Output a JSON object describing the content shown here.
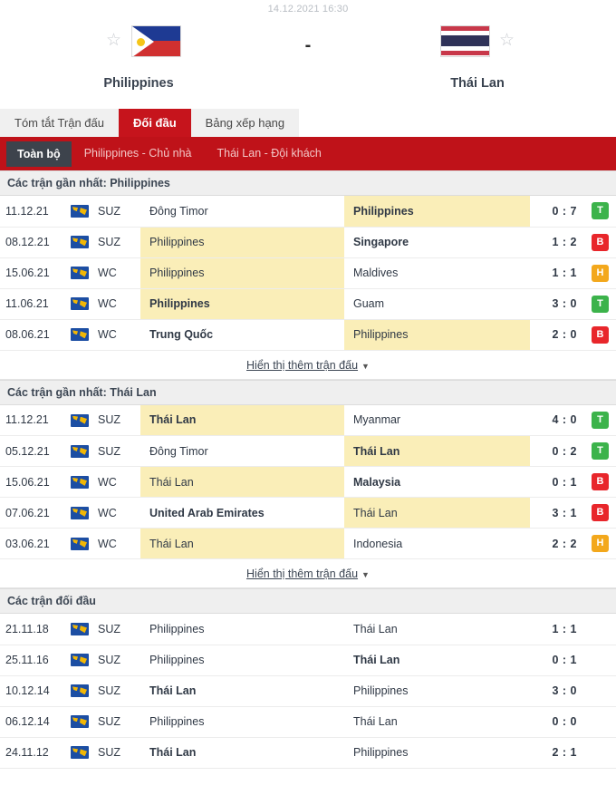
{
  "header": {
    "datetime": "14.12.2021 16:30",
    "home_team": "Philippines",
    "away_team": "Thái Lan",
    "score_separator": "-",
    "star_icon": "star-outline-icon",
    "home_flag": "philippines-flag",
    "away_flag": "thailand-flag"
  },
  "tabs": [
    {
      "label": "Tóm tắt Trận đấu",
      "active": false
    },
    {
      "label": "Đối đầu",
      "active": true
    },
    {
      "label": "Bảng xếp hạng",
      "active": false
    }
  ],
  "filters": [
    {
      "label": "Toàn bộ",
      "active": true
    },
    {
      "label": "Philippines - Chủ nhà",
      "active": false
    },
    {
      "label": "Thái Lan - Đội khách",
      "active": false
    }
  ],
  "show_more_label": "Hiển thị thêm trận đấu",
  "show_more_icon": "chevron-down-icon",
  "competition_icon": "world-map-icon",
  "colors": {
    "brand_red": "#bf1219",
    "tab_red": "#c6141c",
    "dark_chip": "#3d434c",
    "highlight_yellow": "#faeeb8",
    "win_green": "#3cb34b",
    "loss_red": "#e8262b",
    "draw_orange": "#f3a81c"
  },
  "sections": [
    {
      "title": "Các trận gần nhất: Philippines",
      "has_result_badge": true,
      "has_show_more": true,
      "rows": [
        {
          "date": "11.12.21",
          "comp": "SUZ",
          "home": "Đông Timor",
          "away": "Philippines",
          "score": "0 : 7",
          "result": "T",
          "home_bold": false,
          "away_bold": true,
          "home_hl": false,
          "away_hl": true
        },
        {
          "date": "08.12.21",
          "comp": "SUZ",
          "home": "Philippines",
          "away": "Singapore",
          "score": "1 : 2",
          "result": "B",
          "home_bold": false,
          "away_bold": true,
          "home_hl": true,
          "away_hl": false
        },
        {
          "date": "15.06.21",
          "comp": "WC",
          "home": "Philippines",
          "away": "Maldives",
          "score": "1 : 1",
          "result": "H",
          "home_bold": false,
          "away_bold": false,
          "home_hl": true,
          "away_hl": false
        },
        {
          "date": "11.06.21",
          "comp": "WC",
          "home": "Philippines",
          "away": "Guam",
          "score": "3 : 0",
          "result": "T",
          "home_bold": true,
          "away_bold": false,
          "home_hl": true,
          "away_hl": false
        },
        {
          "date": "08.06.21",
          "comp": "WC",
          "home": "Trung Quốc",
          "away": "Philippines",
          "score": "2 : 0",
          "result": "B",
          "home_bold": true,
          "away_bold": false,
          "home_hl": false,
          "away_hl": true
        }
      ]
    },
    {
      "title": "Các trận gần nhất: Thái Lan",
      "has_result_badge": true,
      "has_show_more": true,
      "rows": [
        {
          "date": "11.12.21",
          "comp": "SUZ",
          "home": "Thái Lan",
          "away": "Myanmar",
          "score": "4 : 0",
          "result": "T",
          "home_bold": true,
          "away_bold": false,
          "home_hl": true,
          "away_hl": false
        },
        {
          "date": "05.12.21",
          "comp": "SUZ",
          "home": "Đông Timor",
          "away": "Thái Lan",
          "score": "0 : 2",
          "result": "T",
          "home_bold": false,
          "away_bold": true,
          "home_hl": false,
          "away_hl": true
        },
        {
          "date": "15.06.21",
          "comp": "WC",
          "home": "Thái Lan",
          "away": "Malaysia",
          "score": "0 : 1",
          "result": "B",
          "home_bold": false,
          "away_bold": true,
          "home_hl": true,
          "away_hl": false
        },
        {
          "date": "07.06.21",
          "comp": "WC",
          "home": "United Arab Emirates",
          "away": "Thái Lan",
          "score": "3 : 1",
          "result": "B",
          "home_bold": true,
          "away_bold": false,
          "home_hl": false,
          "away_hl": true
        },
        {
          "date": "03.06.21",
          "comp": "WC",
          "home": "Thái Lan",
          "away": "Indonesia",
          "score": "2 : 2",
          "result": "H",
          "home_bold": false,
          "away_bold": false,
          "home_hl": true,
          "away_hl": false
        }
      ]
    },
    {
      "title": "Các trận đối đầu",
      "has_result_badge": false,
      "has_show_more": false,
      "rows": [
        {
          "date": "21.11.18",
          "comp": "SUZ",
          "home": "Philippines",
          "away": "Thái Lan",
          "score": "1 : 1",
          "result": "",
          "home_bold": false,
          "away_bold": false,
          "home_hl": false,
          "away_hl": false
        },
        {
          "date": "25.11.16",
          "comp": "SUZ",
          "home": "Philippines",
          "away": "Thái Lan",
          "score": "0 : 1",
          "result": "",
          "home_bold": false,
          "away_bold": true,
          "home_hl": false,
          "away_hl": false
        },
        {
          "date": "10.12.14",
          "comp": "SUZ",
          "home": "Thái Lan",
          "away": "Philippines",
          "score": "3 : 0",
          "result": "",
          "home_bold": true,
          "away_bold": false,
          "home_hl": false,
          "away_hl": false
        },
        {
          "date": "06.12.14",
          "comp": "SUZ",
          "home": "Philippines",
          "away": "Thái Lan",
          "score": "0 : 0",
          "result": "",
          "home_bold": false,
          "away_bold": false,
          "home_hl": false,
          "away_hl": false
        },
        {
          "date": "24.11.12",
          "comp": "SUZ",
          "home": "Thái Lan",
          "away": "Philippines",
          "score": "2 : 1",
          "result": "",
          "home_bold": true,
          "away_bold": false,
          "home_hl": false,
          "away_hl": false
        }
      ]
    }
  ]
}
